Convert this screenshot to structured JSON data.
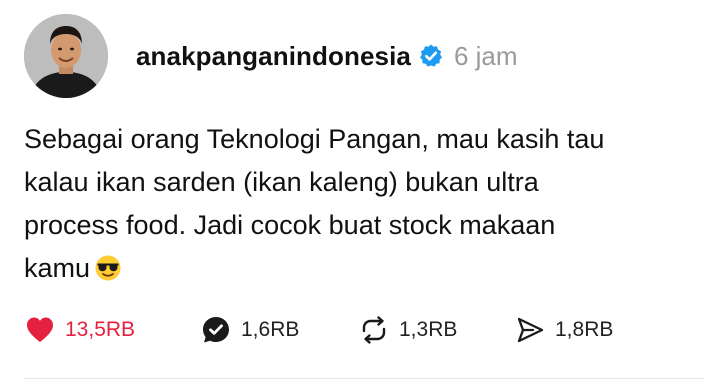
{
  "post": {
    "username": "anakpanganindonesia",
    "time": "6 jam",
    "text_lines": [
      "Sebagai orang Teknologi Pangan, mau kasih tau",
      "kalau ikan sarden (ikan kaleng) bukan ultra",
      "process food. Jadi cocok buat stock makaan",
      "kamu"
    ],
    "emoji": "smiling-face-with-sunglasses"
  },
  "actions": {
    "likes": "13,5RB",
    "replies": "1,6RB",
    "reposts": "1,3RB",
    "shares": "1,8RB"
  },
  "colors": {
    "like_red": "#e4213f",
    "verified_blue": "#1d9bf0",
    "muted_text": "#9a9a9a"
  }
}
